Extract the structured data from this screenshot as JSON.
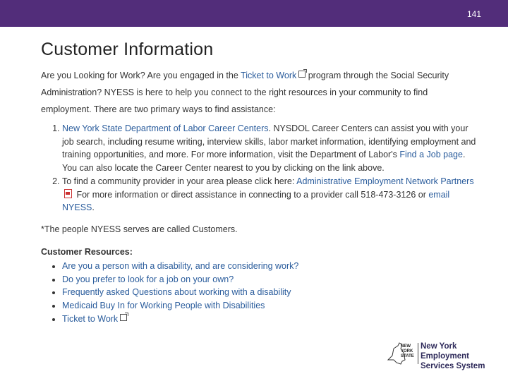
{
  "slide": {
    "number": "141"
  },
  "title": "Customer Information",
  "intro": {
    "part1": "Are you Looking for Work? Are you engaged in the ",
    "link_ticket": "Ticket to Work",
    "part2": " program through the Social Security Administration? NYESS is here to help you connect to the right resources in your community to find employment. There are two primary ways to find assistance:"
  },
  "steps": [
    {
      "link": "New York State Department of Labor Career Centers",
      "text1": ". NYSDOL Career Centers can assist you with your job search, including resume writing, interview skills, labor market information, identifying employment and training opportunities, and more. For more information, visit the Department of Labor's ",
      "link2": "Find a Job page",
      "text2": ". You can also locate the Career Center nearest to you by clicking on the link above."
    },
    {
      "text1": "To find a community provider in your area please click here: ",
      "link": "Administrative Employment Network Partners",
      "text2": " For more information or direct assistance in connecting to a provider call 518-473-3126 or ",
      "link2": "email NYESS",
      "text3": "."
    }
  ],
  "note": "*The people NYESS serves are called Customers.",
  "resources": {
    "title": "Customer Resources:",
    "items": [
      "Are you a person with a disability, and are considering work?",
      "Do you prefer to look for a job on your own?",
      "Frequently asked Questions about working with a disability",
      "Medicaid Buy In for Working People with Disabilities",
      "Ticket to Work"
    ]
  },
  "logo": {
    "state_line1": "NEW",
    "state_line2": "YORK",
    "state_line3": "STATE",
    "name_line1": "New York Employment",
    "name_line2": "Services System"
  },
  "colors": {
    "header": "#522d7a",
    "link": "#2a5c9c",
    "pdf": "#cc3333"
  }
}
